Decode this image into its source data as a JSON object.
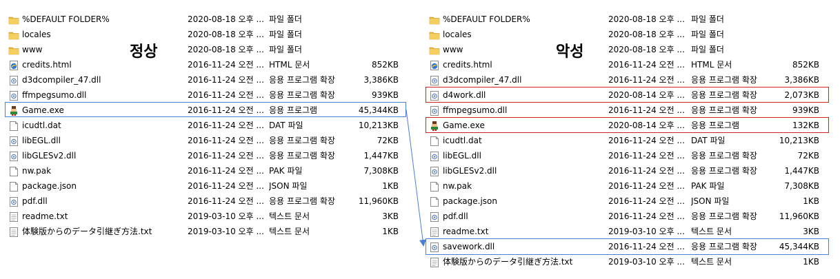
{
  "panels": {
    "normal": {
      "label": "정상",
      "files": [
        {
          "name": "%DEFAULT FOLDER%",
          "date": "2020-08-18 오후 ...",
          "type": "파일 폴더",
          "size": "",
          "icon": "folder-icon"
        },
        {
          "name": "locales",
          "date": "2020-08-18 오후 ...",
          "type": "파일 폴더",
          "size": "",
          "icon": "folder-icon"
        },
        {
          "name": "www",
          "date": "2020-08-18 오후 ...",
          "type": "파일 폴더",
          "size": "",
          "icon": "folder-icon"
        },
        {
          "name": "credits.html",
          "date": "2016-11-24 오전 ...",
          "type": "HTML 문서",
          "size": "852KB",
          "icon": "html-icon"
        },
        {
          "name": "d3dcompiler_47.dll",
          "date": "2016-11-24 오전 ...",
          "type": "응용 프로그램 확장",
          "size": "3,386KB",
          "icon": "dll-icon"
        },
        {
          "name": "ffmpegsumo.dll",
          "date": "2016-11-24 오전 ...",
          "type": "응용 프로그램 확장",
          "size": "939KB",
          "icon": "dll-icon"
        },
        {
          "name": "Game.exe",
          "date": "2016-11-24 오전 ...",
          "type": "응용 프로그램",
          "size": "45,344KB",
          "icon": "exe-icon"
        },
        {
          "name": "icudtl.dat",
          "date": "2016-11-24 오전 ...",
          "type": "DAT 파일",
          "size": "10,213KB",
          "icon": "file-icon"
        },
        {
          "name": "libEGL.dll",
          "date": "2016-11-24 오전 ...",
          "type": "응용 프로그램 확장",
          "size": "72KB",
          "icon": "dll-icon"
        },
        {
          "name": "libGLESv2.dll",
          "date": "2016-11-24 오전 ...",
          "type": "응용 프로그램 확장",
          "size": "1,447KB",
          "icon": "dll-icon"
        },
        {
          "name": "nw.pak",
          "date": "2016-11-24 오전 ...",
          "type": "PAK 파일",
          "size": "7,308KB",
          "icon": "file-icon"
        },
        {
          "name": "package.json",
          "date": "2016-11-24 오전 ...",
          "type": "JSON 파일",
          "size": "1KB",
          "icon": "file-icon"
        },
        {
          "name": "pdf.dll",
          "date": "2016-11-24 오전 ...",
          "type": "응용 프로그램 확장",
          "size": "11,960KB",
          "icon": "dll-icon"
        },
        {
          "name": "readme.txt",
          "date": "2019-03-10 오후 ...",
          "type": "텍스트 문서",
          "size": "3KB",
          "icon": "text-icon"
        },
        {
          "name": "体験版からのデータ引継ぎ方法.txt",
          "date": "2019-03-10 오후 ...",
          "type": "텍스트 문서",
          "size": "1KB",
          "icon": "text-icon"
        }
      ]
    },
    "malicious": {
      "label": "악성",
      "files": [
        {
          "name": "%DEFAULT FOLDER%",
          "date": "2020-08-18 오후 ...",
          "type": "파일 폴더",
          "size": "",
          "icon": "folder-icon"
        },
        {
          "name": "locales",
          "date": "2020-08-18 오후 ...",
          "type": "파일 폴더",
          "size": "",
          "icon": "folder-icon"
        },
        {
          "name": "www",
          "date": "2020-08-18 오후 ...",
          "type": "파일 폴더",
          "size": "",
          "icon": "folder-icon"
        },
        {
          "name": "credits.html",
          "date": "2016-11-24 오전 ...",
          "type": "HTML 문서",
          "size": "852KB",
          "icon": "html-icon"
        },
        {
          "name": "d3dcompiler_47.dll",
          "date": "2016-11-24 오전 ...",
          "type": "응용 프로그램 확장",
          "size": "3,386KB",
          "icon": "dll-icon"
        },
        {
          "name": "d4work.dll",
          "date": "2020-08-14 오후 ...",
          "type": "응용 프로그램 확장",
          "size": "2,073KB",
          "icon": "dll-icon"
        },
        {
          "name": "ffmpegsumo.dll",
          "date": "2016-11-24 오전 ...",
          "type": "응용 프로그램 확장",
          "size": "939KB",
          "icon": "dll-icon"
        },
        {
          "name": "Game.exe",
          "date": "2020-08-14 오후 ...",
          "type": "응용 프로그램",
          "size": "132KB",
          "icon": "exe-icon"
        },
        {
          "name": "icudtl.dat",
          "date": "2016-11-24 오전 ...",
          "type": "DAT 파일",
          "size": "10,213KB",
          "icon": "file-icon"
        },
        {
          "name": "libEGL.dll",
          "date": "2016-11-24 오전 ...",
          "type": "응용 프로그램 확장",
          "size": "72KB",
          "icon": "dll-icon"
        },
        {
          "name": "libGLESv2.dll",
          "date": "2016-11-24 오전 ...",
          "type": "응용 프로그램 확장",
          "size": "1,447KB",
          "icon": "dll-icon"
        },
        {
          "name": "nw.pak",
          "date": "2016-11-24 오전 ...",
          "type": "PAK 파일",
          "size": "7,308KB",
          "icon": "file-icon"
        },
        {
          "name": "package.json",
          "date": "2016-11-24 오전 ...",
          "type": "JSON 파일",
          "size": "1KB",
          "icon": "file-icon"
        },
        {
          "name": "pdf.dll",
          "date": "2016-11-24 오전 ...",
          "type": "응용 프로그램 확장",
          "size": "11,960KB",
          "icon": "dll-icon"
        },
        {
          "name": "readme.txt",
          "date": "2019-03-10 오후 ...",
          "type": "텍스트 문서",
          "size": "3KB",
          "icon": "text-icon"
        },
        {
          "name": "savework.dll",
          "date": "2016-11-24 오전 ...",
          "type": "응용 프로그램 확장",
          "size": "45,344KB",
          "icon": "dll-icon"
        },
        {
          "name": "体験版からのデータ引継ぎ方法.txt",
          "date": "2019-03-10 오후 ...",
          "type": "텍스트 문서",
          "size": "1KB",
          "icon": "text-icon"
        }
      ]
    }
  },
  "colors": {
    "highlight_blue": "#4a7fd4",
    "highlight_red": "#d02020",
    "folder": "#e8b83a"
  }
}
